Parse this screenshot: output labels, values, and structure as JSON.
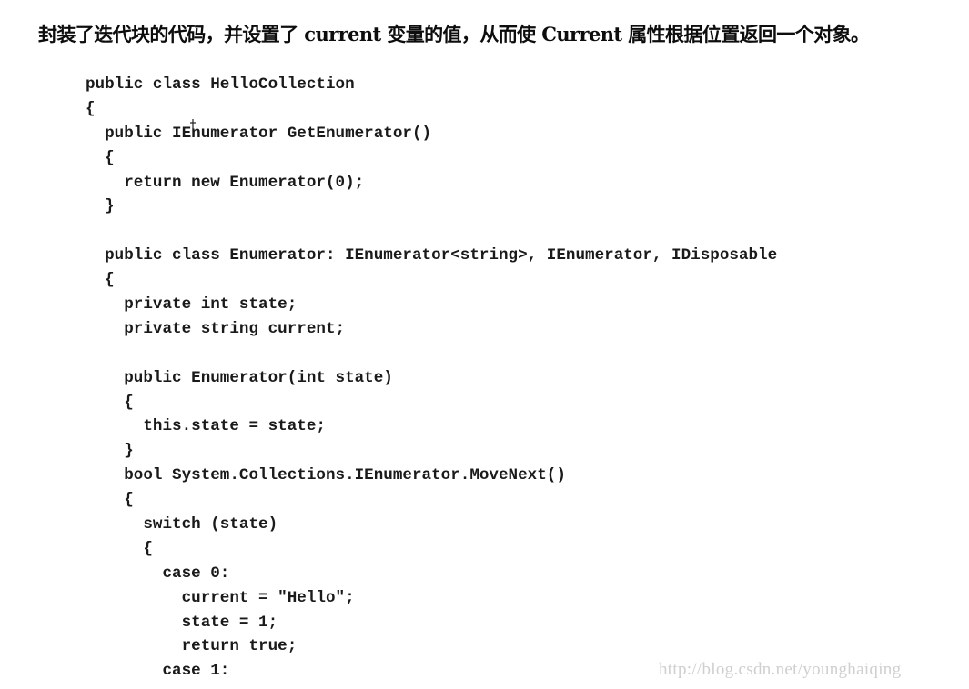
{
  "document": {
    "intro_text": "封装了迭代块的代码，并设置了 current 变量的值，从而使 Current 属性根据位置返回一个对象。",
    "code_lines": [
      "public class HelloCollection",
      "{",
      "  public IEnumerator GetEnumerator()",
      "  {",
      "    return new Enumerator(0);",
      "  }",
      "",
      "  public class Enumerator: IEnumerator<string>, IEnumerator, IDisposable",
      "  {",
      "    private int state;",
      "    private string current;",
      "",
      "    public Enumerator(int state)",
      "    {",
      "      this.state = state;",
      "    }",
      "    bool System.Collections.IEnumerator.MoveNext()",
      "    {",
      "      switch (state)",
      "      {",
      "        case 0:",
      "          current = \"Hello\";",
      "          state = 1;",
      "          return true;",
      "        case 1:"
    ],
    "cursor_glyph": "ŧ",
    "watermark": "http://blog.csdn.net/younghaiqing"
  }
}
